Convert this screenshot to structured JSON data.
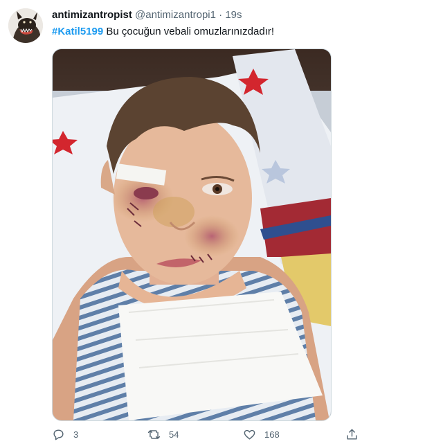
{
  "tweet": {
    "display_name": "antimizantropist",
    "handle": "@antimizantropi1",
    "separator": "·",
    "time": "19s",
    "hashtag": "#Katil5199",
    "body": " Bu çocuğun vebali omuzlarınızdadır!",
    "replies": "3",
    "retweets": "54",
    "likes": "168"
  },
  "icons": {
    "reply": "reply-icon",
    "retweet": "retweet-icon",
    "like": "like-icon",
    "share": "share-icon"
  },
  "colors": {
    "link": "#1d9bf0",
    "secondary_text": "#536471",
    "border": "#cfd9de"
  }
}
